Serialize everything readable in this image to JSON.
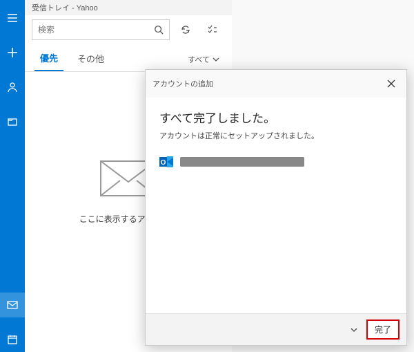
{
  "titlebar": {
    "text": "受信トレイ - Yahoo"
  },
  "search": {
    "placeholder": "検索"
  },
  "tabs": {
    "focused": "優先",
    "other": "その他",
    "filter": "すべて"
  },
  "empty": {
    "message": "ここに表示するアイテムは"
  },
  "dialog": {
    "title": "アカウントの追加",
    "heading": "すべて完了しました。",
    "subtext": "アカウントは正常にセットアップされました。",
    "done": "完了"
  }
}
